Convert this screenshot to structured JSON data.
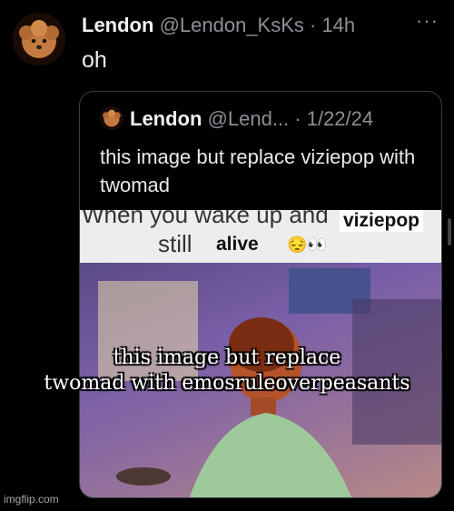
{
  "tweet": {
    "author_name": "Lendon",
    "author_meta": "@Lendon_KsKs · 14h",
    "text": "oh",
    "more_icon": "ellipsis-icon"
  },
  "quoted_tweet": {
    "author_name": "Lendon",
    "author_meta": "@Lend... · 1/22/24",
    "text": "this image but replace viziepop with twomad"
  },
  "meme": {
    "caption_line1": "When you wake up and",
    "caption_line2": "still",
    "alive_label": "alive",
    "viziepop_label": "viziepop",
    "emoji": "😔👀"
  },
  "overlay_caption": {
    "line1": "this image but replace",
    "line2": "twomad with emosruleoverpeasants"
  },
  "watermark": "imgflip.com"
}
